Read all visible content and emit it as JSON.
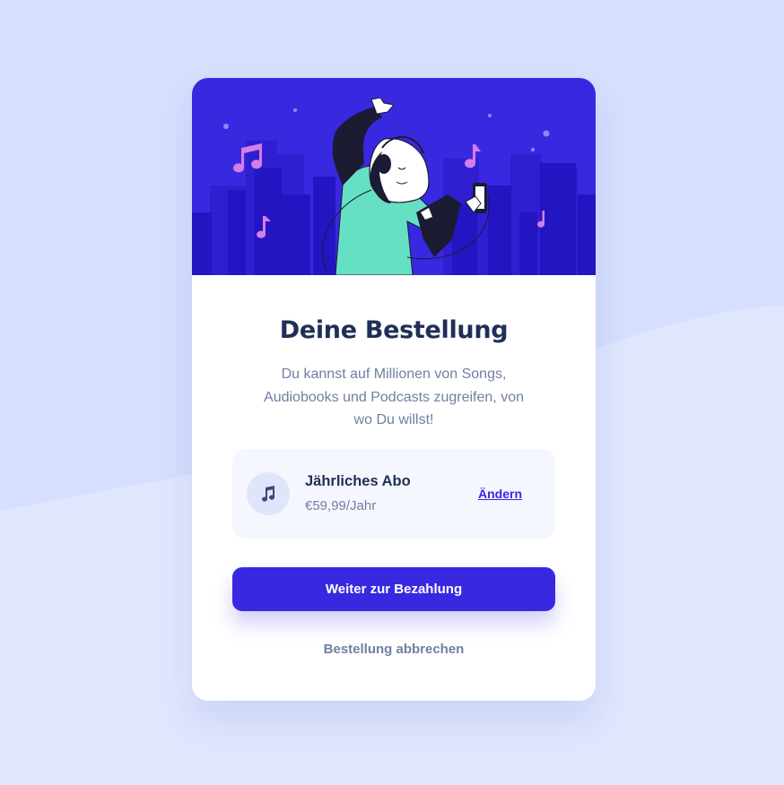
{
  "colors": {
    "page_background": "#e0e6fe",
    "accent": "#3829e0",
    "hero_background": "#3829e0",
    "heading": "#1f2f56",
    "muted_text": "#7080a1",
    "plan_background": "#f5f7ff"
  },
  "order": {
    "title": "Deine Bestellung",
    "description": "Du kannst auf Millionen von Songs, Audiobooks und Podcasts zugreifen, von wo Du willst!"
  },
  "plan": {
    "icon": "music-note-icon",
    "name": "Jährliches Abo",
    "price": "€59,99/Jahr",
    "change_label": "Ändern"
  },
  "actions": {
    "proceed_label": "Weiter zur Bezahlung",
    "cancel_label": "Bestellung abbrechen"
  }
}
